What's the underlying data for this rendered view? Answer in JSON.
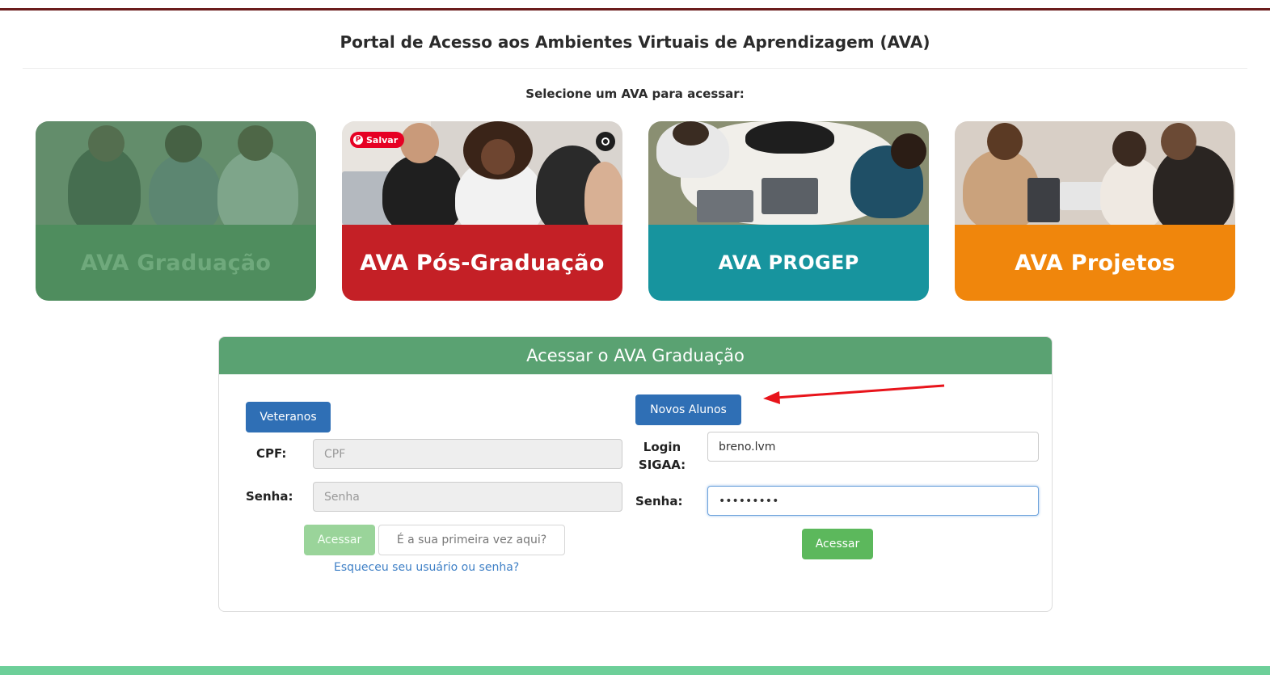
{
  "page": {
    "title": "Portal de Acesso aos Ambientes Virtuais de Aprendizagem (AVA)",
    "select_prompt": "Selecione um AVA para acessar:"
  },
  "cards": [
    {
      "name": "AVA Graduação",
      "color": "#4f8d5e",
      "state": "selected"
    },
    {
      "name": "AVA Pós-Graduação",
      "color": "#c42026",
      "overlay_badge": "Salvar"
    },
    {
      "name": "AVA PROGEP",
      "color": "#17949e"
    },
    {
      "name": "AVA Projetos",
      "color": "#f0860c"
    }
  ],
  "login": {
    "header": "Acessar o AVA Graduação",
    "veteranos": {
      "tab_label": "Veteranos",
      "cpf_label": "CPF:",
      "cpf_placeholder": "CPF",
      "senha_label": "Senha:",
      "senha_placeholder": "Senha",
      "submit_label": "Acessar",
      "first_time_label": "É a sua primeira vez aqui?",
      "forgot_label": "Esqueceu seu usuário ou senha?"
    },
    "novos": {
      "tab_label": "Novos Alunos",
      "login_label_line1": "Login",
      "login_label_line2": "SIGAA:",
      "login_value": "breno.lvm",
      "senha_label": "Senha:",
      "senha_value": "•••••••••",
      "submit_label": "Acessar"
    }
  },
  "colors": {
    "top_bar": "#6b1d1d",
    "panel_header": "#5aa272",
    "primary_blue": "#2f6fb5",
    "success_green": "#5cb85c",
    "footer": "#6dcf99",
    "annotation_arrow": "#e8141b"
  }
}
